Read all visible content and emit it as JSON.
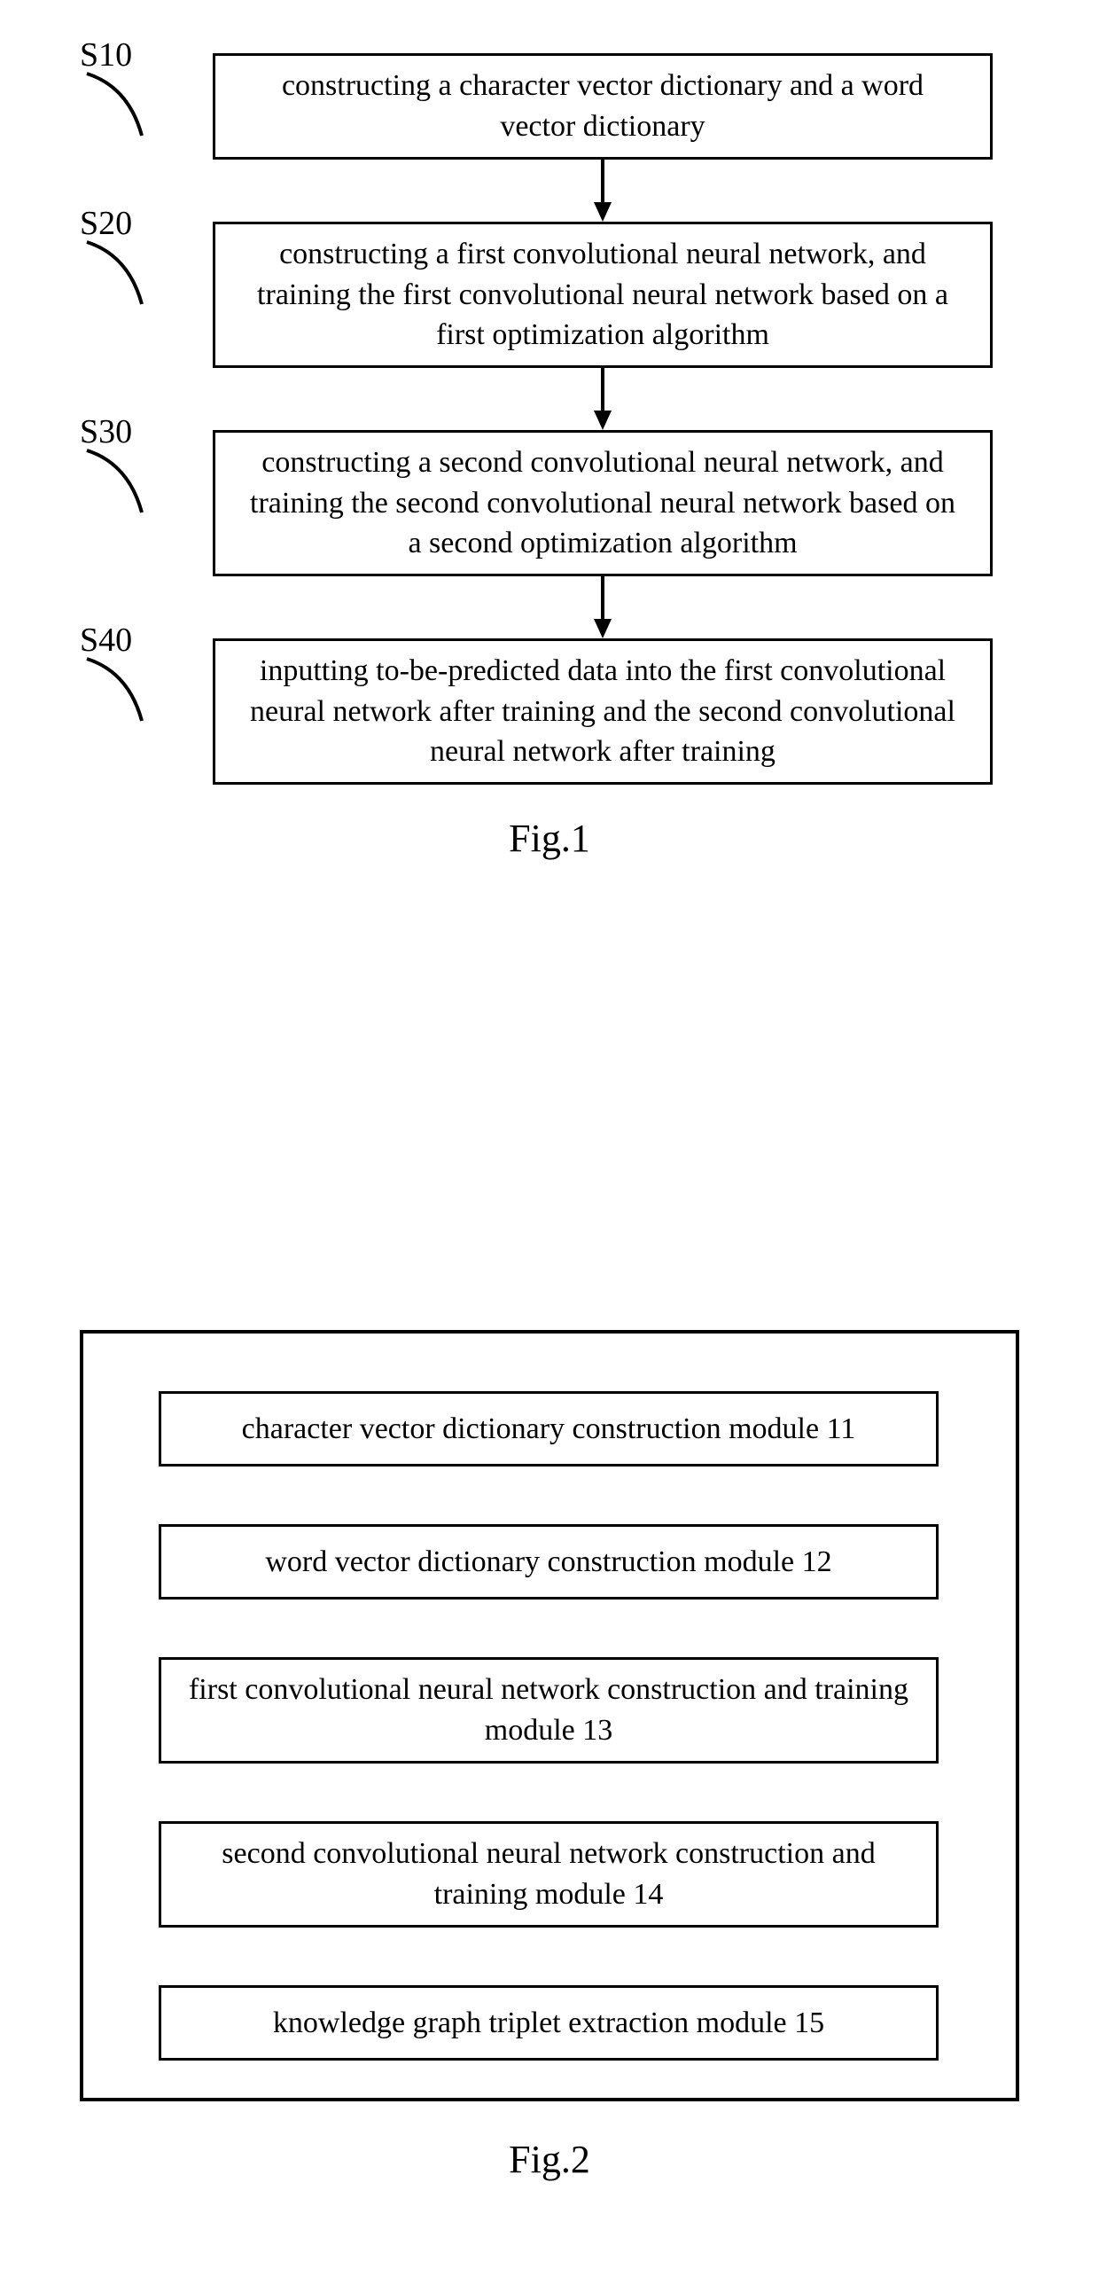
{
  "fig1": {
    "steps": [
      {
        "label": "S10",
        "text": "constructing a character vector dictionary and a word vector dictionary"
      },
      {
        "label": "S20",
        "text": "constructing a first convolutional neural network, and training the first convolutional neural network based on a first optimization algorithm"
      },
      {
        "label": "S30",
        "text": "constructing a second convolutional neural network, and training the second convolutional neural network based on a second optimization algorithm"
      },
      {
        "label": "S40",
        "text": "inputting to-be-predicted data into the first convolutional neural network after training and the second convolutional neural network after training"
      }
    ],
    "caption": "Fig.1"
  },
  "fig2": {
    "modules": [
      "character vector dictionary construction module 11",
      "word vector dictionary construction module 12",
      "first convolutional neural network construction and training module 13",
      "second convolutional neural network construction and training module 14",
      "knowledge graph triplet extraction module 15"
    ],
    "caption": "Fig.2"
  }
}
